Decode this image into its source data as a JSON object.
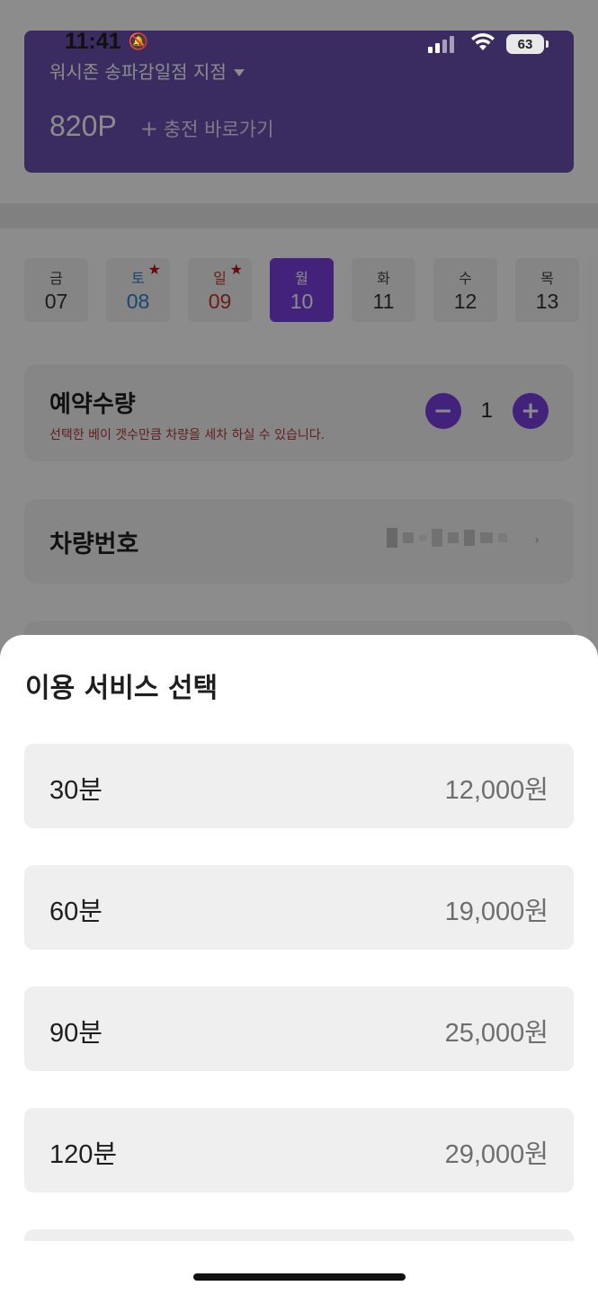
{
  "status_bar": {
    "time": "11:41",
    "battery": "63"
  },
  "header": {
    "branch": "워시존 송파감일점 지점",
    "points": "820P",
    "charge_label": "충전 바로가기"
  },
  "dates": [
    {
      "dow": "금",
      "day": "07",
      "kind": "normal",
      "starred": false
    },
    {
      "dow": "토",
      "day": "08",
      "kind": "sat",
      "starred": true
    },
    {
      "dow": "일",
      "day": "09",
      "kind": "sun",
      "starred": true
    },
    {
      "dow": "월",
      "day": "10",
      "kind": "selected",
      "starred": false
    },
    {
      "dow": "화",
      "day": "11",
      "kind": "normal",
      "starred": false
    },
    {
      "dow": "수",
      "day": "12",
      "kind": "normal",
      "starred": false
    },
    {
      "dow": "목",
      "day": "13",
      "kind": "normal",
      "starred": false
    }
  ],
  "quantity": {
    "title": "예약수량",
    "description": "선택한 베이 갯수만큼 차량을 세차 하실 수 있습니다.",
    "value": "1"
  },
  "vehicle": {
    "title": "차량번호"
  },
  "sheet": {
    "title": "이용 서비스 선택",
    "services": [
      {
        "name": "30분",
        "price": "12,000원"
      },
      {
        "name": "60분",
        "price": "19,000원"
      },
      {
        "name": "90분",
        "price": "25,000원"
      },
      {
        "name": "120분",
        "price": "29,000원"
      }
    ]
  },
  "colors": {
    "accent": "#7a3fe0",
    "header": "#6b4fb1",
    "saturday": "#2f7fd1",
    "sunday": "#c0392b"
  }
}
